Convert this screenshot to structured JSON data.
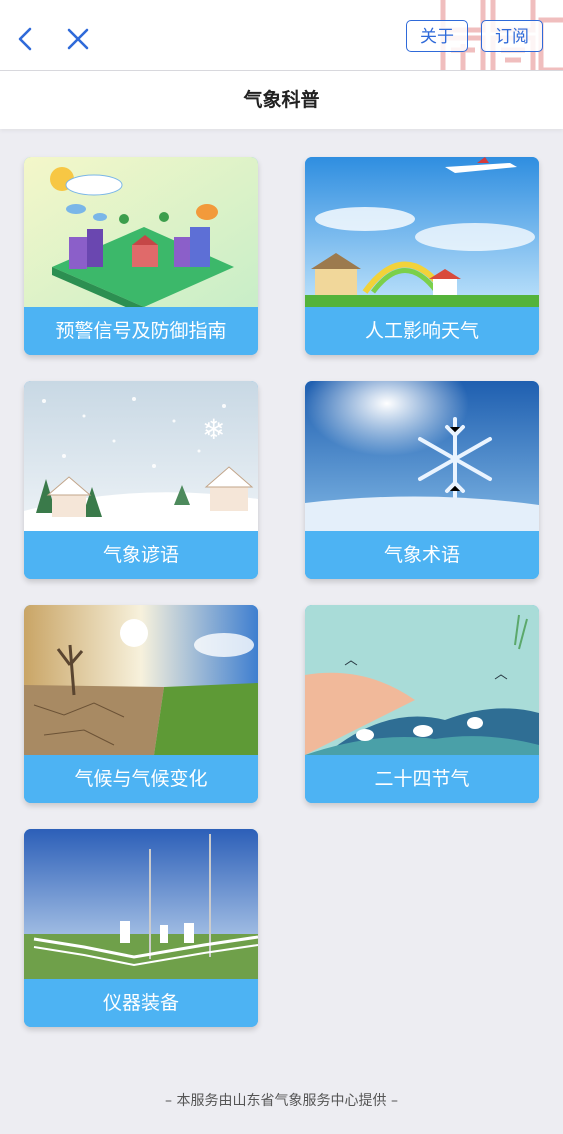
{
  "header": {
    "about_label": "关于",
    "subscribe_label": "订阅",
    "accent": "#2f6ad9"
  },
  "subheader": {
    "title": "气象科普"
  },
  "cards": [
    {
      "label": "预警信号及防御指南"
    },
    {
      "label": "人工影响天气"
    },
    {
      "label": "气象谚语"
    },
    {
      "label": "气象术语"
    },
    {
      "label": "气候与气候变化"
    },
    {
      "label": "二十四节气"
    },
    {
      "label": "仪器装备"
    }
  ],
  "footer": {
    "text": "– 本服务由山东省气象服务中心提供 –"
  },
  "colors": {
    "card_label_bg": "#4db3f3",
    "page_bg": "#ededf2"
  }
}
